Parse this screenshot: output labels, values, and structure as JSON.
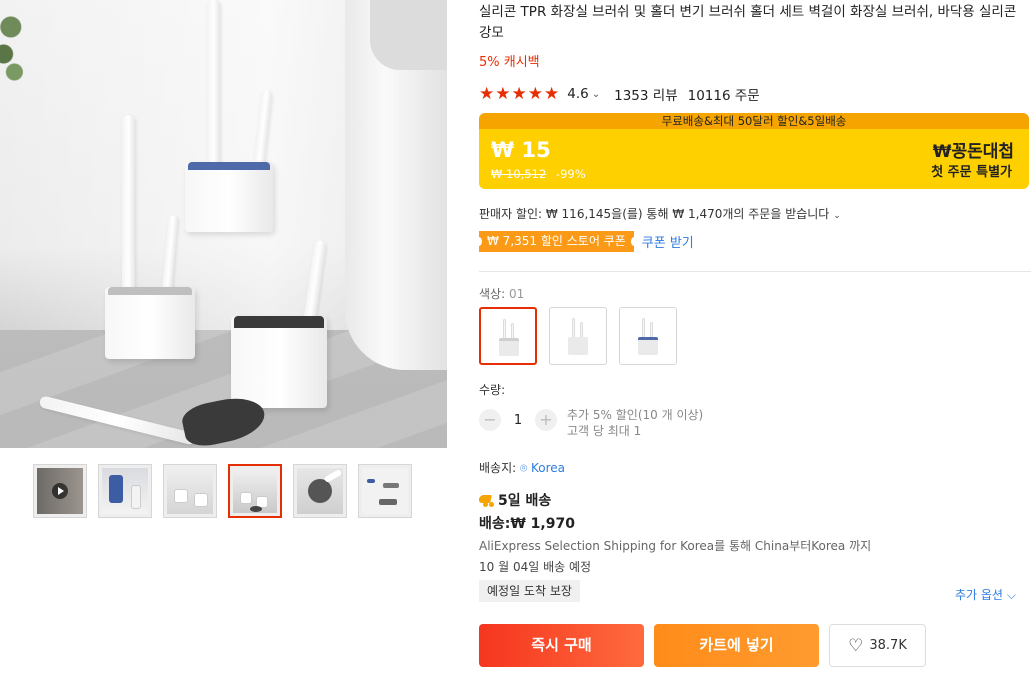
{
  "product": {
    "title": "실리콘 TPR 화장실 브러쉬 및 홀더 변기 브러쉬 홀더 세트 벽걸이 화장실 브러쉬, 바닥용 실리콘 강모",
    "cashback": "5% 캐시백"
  },
  "rating": {
    "stars": 5,
    "value": "4.6",
    "reviews": "1353 리뷰",
    "orders": "10116 주문"
  },
  "promo": {
    "banner": "무료배송&최대 50달러 할인&5일배송",
    "price_now": "₩ 15",
    "price_was": "₩ 10,512",
    "discount": "-99%",
    "brand_title": "₩꽁돈대첩",
    "brand_sub": "첫 주문 특별가",
    "brand_color": "#ffd000",
    "banner_color": "#f5a400"
  },
  "seller": {
    "discount_text": "판매자 할인: ₩ 116,145을(를) 통해 ₩ 1,470개의 주문을 받습니다",
    "coupon": "₩ 7,351 할인 스토어 쿠폰",
    "coupon_link": "쿠폰 받기"
  },
  "color": {
    "label": "색상: ",
    "selected": "01",
    "options": [
      "01",
      "02",
      "03"
    ]
  },
  "quantity": {
    "label": "수량:",
    "value": "1",
    "minus": "−",
    "plus": "+",
    "note1": "추가 5% 할인(10 개 이상)",
    "note2": "고객 당 최대 1"
  },
  "shipping": {
    "label": "배송지: ",
    "location": "Korea",
    "fast": "5일 배송",
    "fee": "배송:₩ 1,970",
    "via": "AliExpress Selection Shipping for Korea를 통해 China부터Korea 까지",
    "eta": "10 월 04일 배송 예정",
    "guarantee": "예정일 도착 보장",
    "more": "추가 옵션"
  },
  "actions": {
    "buy": "즉시 구매",
    "cart": "카트에 넣기",
    "wishlist_count": "38.7K"
  },
  "gallery": {
    "thumb_count": 6,
    "active_index": 3
  },
  "colors": {
    "accent": "#e62e04",
    "link": "#2e7de1",
    "buy": "#f5361f",
    "cart": "#ff8c1a"
  }
}
